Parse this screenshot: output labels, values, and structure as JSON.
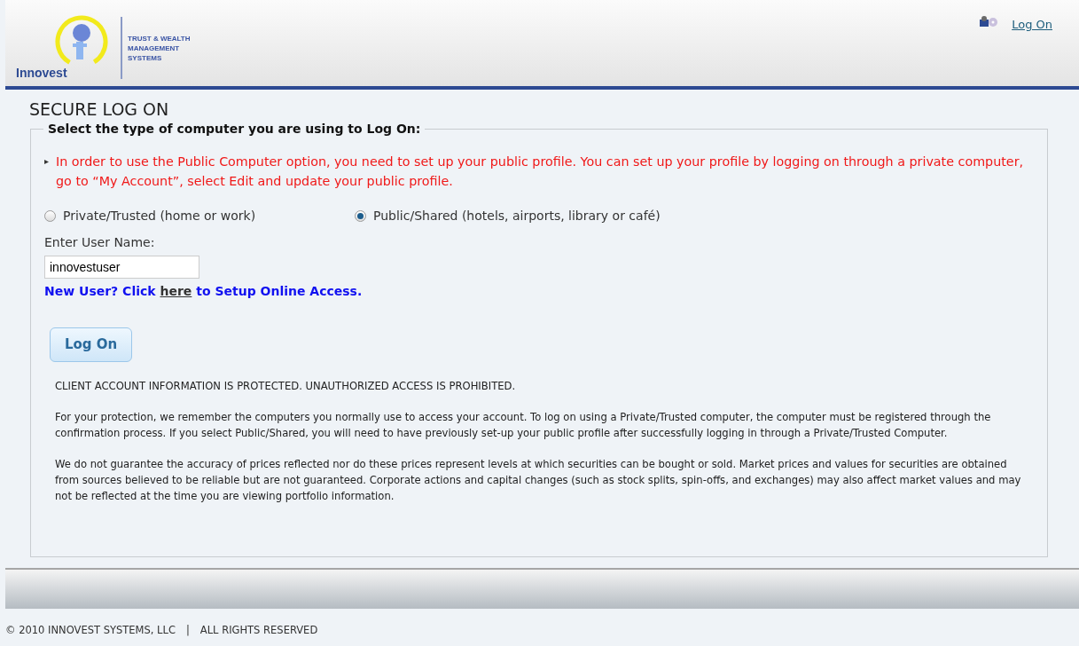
{
  "header": {
    "logo_name": "Innovest",
    "logo_tagline": [
      "TRUST & WEALTH",
      "MANAGEMENT",
      "SYSTEMS"
    ],
    "log_on_link": "Log On"
  },
  "page_title": "SECURE LOG ON",
  "form": {
    "legend": "Select the type of computer you are using to Log On:",
    "notice_marker": "▸",
    "notice": "In order to use the Public Computer option, you need to set up your public profile. You can set up your profile by logging on through a private computer, go to “My Account”, select Edit and update your public profile.",
    "options": [
      {
        "label": "Private/Trusted (home or work)",
        "selected": false
      },
      {
        "label": "Public/Shared (hotels, airports, library or café)",
        "selected": true
      }
    ],
    "username_label": "Enter User Name:",
    "username_value": "innovestuser",
    "new_user": {
      "before": "New User? Click",
      "link": "here",
      "after": "to Setup Online Access."
    },
    "button": "Log On",
    "paragraphs": [
      "CLIENT ACCOUNT INFORMATION IS PROTECTED. UNAUTHORIZED ACCESS IS PROHIBITED.",
      "For your protection, we remember the computers you normally use to access your account. To log on using a Private/Trusted computer, the computer must be registered through the confirmation process. If you select Public/Shared, you will need to have previously set-up your public profile after successfully logging in through a Private/Trusted Computer.",
      "We do not guarantee the accuracy of prices reflected nor do these prices represent levels at which securities can be bought or sold. Market prices and values for securities are obtained from sources believed to be reliable but are not guaranteed. Corporate actions and capital changes (such as stock splits, spin-offs, and exchanges) may also affect market values and may not be reflected at the time you are viewing portfolio information."
    ]
  },
  "footer": {
    "copyright": "© 2010 INNOVEST SYSTEMS, LLC",
    "separator": "|",
    "rights": "ALL RIGHTS RESERVED"
  }
}
